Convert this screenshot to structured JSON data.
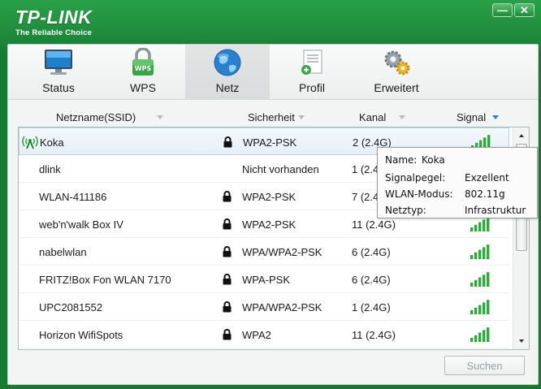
{
  "header": {
    "brand": "TP-LINK",
    "tagline": "The Reliable Choice",
    "minimize_glyph": "—",
    "close_glyph": "✕"
  },
  "nav": {
    "items": [
      {
        "label": "Status",
        "icon": "monitor-icon",
        "active": false
      },
      {
        "label": "WPS",
        "icon": "wps-lock-icon",
        "active": false
      },
      {
        "label": "Netz",
        "icon": "globe-icon",
        "active": true
      },
      {
        "label": "Profil",
        "icon": "profile-document-icon",
        "active": false
      },
      {
        "label": "Erweitert",
        "icon": "gears-icon",
        "active": false
      }
    ]
  },
  "columns": {
    "ssid": "Netzname(SSID)",
    "security": "Sicherheit",
    "channel": "Kanal",
    "signal": "Signal"
  },
  "networks": [
    {
      "ssid": "Koka",
      "locked": true,
      "security": "WPA2-PSK",
      "channel": "2 (2.4G)",
      "connected": true,
      "selected": true
    },
    {
      "ssid": "dlink",
      "locked": false,
      "security": "Nicht vorhanden",
      "channel": "1 (2.4G)",
      "connected": false,
      "selected": false
    },
    {
      "ssid": "WLAN-411186",
      "locked": true,
      "security": "WPA2-PSK",
      "channel": "7 (2.4G)",
      "connected": false,
      "selected": false
    },
    {
      "ssid": "web'n'walk Box IV",
      "locked": true,
      "security": "WPA2-PSK",
      "channel": "11 (2.4G)",
      "connected": false,
      "selected": false
    },
    {
      "ssid": "nabelwlan",
      "locked": true,
      "security": "WPA/WPA2-PSK",
      "channel": "6 (2.4G)",
      "connected": false,
      "selected": false
    },
    {
      "ssid": "FRITZ!Box Fon WLAN 7170",
      "locked": true,
      "security": "WPA-PSK",
      "channel": "6 (2.4G)",
      "connected": false,
      "selected": false
    },
    {
      "ssid": "UPC2081552",
      "locked": true,
      "security": "WPA/WPA2-PSK",
      "channel": "1 (2.4G)",
      "connected": false,
      "selected": false
    },
    {
      "ssid": "Horizon WifiSpots",
      "locked": true,
      "security": "WPA2",
      "channel": "11 (2.4G)",
      "connected": false,
      "selected": false
    }
  ],
  "tooltip": {
    "name_label": "Name:",
    "name_value": "Koka",
    "signal_label": "Signalpegel:",
    "signal_value": "Exzellent",
    "mode_label": "WLAN-Modus:",
    "mode_value": "802.11g",
    "type_label": "Netztyp:",
    "type_value": "Infrastruktur"
  },
  "search_button": "Suchen",
  "colors": {
    "brand_green": "#167a33",
    "signal_green": "#2fa83c",
    "sort_active": "#2e7bd1"
  }
}
